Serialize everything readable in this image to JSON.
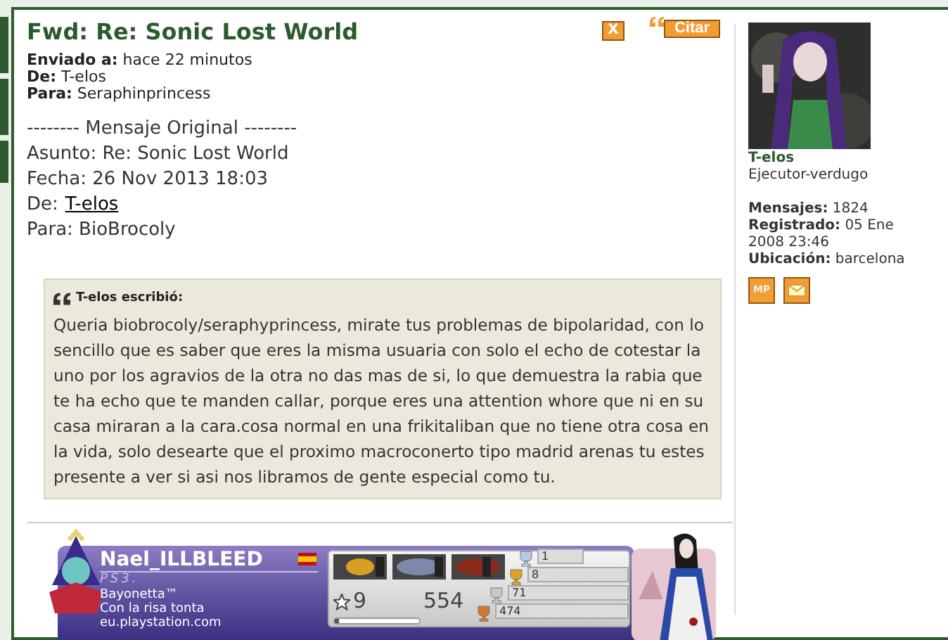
{
  "message": {
    "title": "Fwd: Re: Sonic Lost World",
    "delete_button": "X",
    "quote_button": "Citar",
    "meta": [
      {
        "label": "Enviado a:",
        "value": "hace 22 minutos"
      },
      {
        "label": "De:",
        "value": "T-elos"
      },
      {
        "label": "Para:",
        "value": "Seraphinprincess"
      }
    ],
    "body": [
      {
        "kind": "line",
        "text": "-------- Mensaje Original --------"
      },
      {
        "kind": "line",
        "text": "Asunto: Re: Sonic Lost World"
      },
      {
        "kind": "line",
        "text": "Fecha: 26 Nov 2013 18:03"
      },
      {
        "kind": "link",
        "prefix": "De:",
        "text": "T-elos"
      },
      {
        "kind": "line",
        "text": "Para: BioBrocoly"
      }
    ],
    "quote": {
      "author": "T-elos escribió:",
      "text": "Queria biobrocoly/seraphyprincess, mirate tus problemas de bipolaridad, con lo sencillo que es saber que eres la misma usuaria con solo el echo de cotestar la uno por los agravios de la otra no das mas de si, lo que demuestra la rabia que te ha echo que te manden callar, porque eres una attention whore que ni en su casa miraran a la cara.cosa normal en una frikitaliban que no tiene otra cosa en la vida, solo desearte que el proximo macroconerto tipo madrid arenas tu estes presente a ver si asi nos libramos de gente especial como tu."
    }
  },
  "signature": {
    "name": "Nael_ILLBLEED",
    "platform": "PS3.",
    "game": "Bayonetta™",
    "status": "Con la risa tonta",
    "site": "eu.playstation.com",
    "level": "9",
    "points": "554",
    "level_bar": {
      "level": 0.05
    },
    "trophies": [
      {
        "kind": "platinum",
        "count": "1"
      },
      {
        "kind": "gold",
        "count": "8"
      },
      {
        "kind": "silver",
        "count": "71"
      },
      {
        "kind": "bronze",
        "count": "474"
      }
    ]
  },
  "profile": {
    "username": "T-elos",
    "rank": "Ejecutor-verdugo",
    "stats": [
      {
        "label": "Mensajes:",
        "value": "1824"
      },
      {
        "label": "Registrado:",
        "value": "05 Ene 2008 23:46"
      },
      {
        "label": "Ubicación:",
        "value": "barcelona"
      }
    ],
    "pm_button": "MP"
  }
}
